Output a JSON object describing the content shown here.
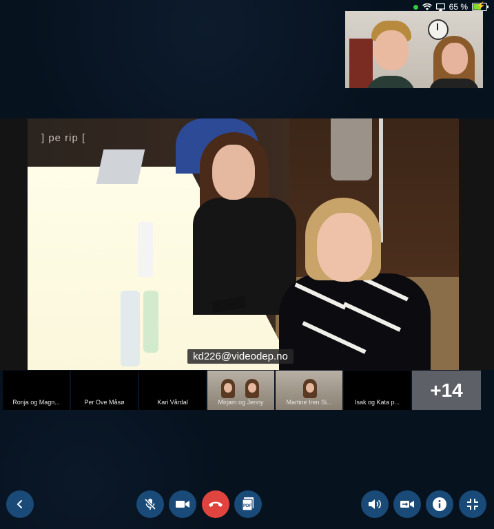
{
  "status_bar": {
    "battery": "65 %"
  },
  "main_video": {
    "caption": "kd226@videodep.no",
    "sign_text": "] pe rip ["
  },
  "participants": [
    {
      "name": "Ronja og Magn..."
    },
    {
      "name": "Per Ove Måsø"
    },
    {
      "name": "Kari Vårdal"
    },
    {
      "name": "Mirjam og Jenny"
    },
    {
      "name": "Martine Iren Si..."
    },
    {
      "name": "Isak og Kata p..."
    }
  ],
  "more_participants": "+14",
  "controls": {
    "back": "chevron-left-icon",
    "mute": "mic-off-icon",
    "camera": "video-camera-icon",
    "hangup": "phone-hangup-icon",
    "pdf": "pdf-icon",
    "speaker": "speaker-icon",
    "switch_camera": "switch-camera-icon",
    "info": "info-icon",
    "fullscreen": "exit-fullscreen-icon"
  },
  "colors": {
    "background": "#07121f",
    "control_button": "#1a4a78",
    "hangup_button": "#e0443e",
    "more_tile": "#5d6066"
  }
}
